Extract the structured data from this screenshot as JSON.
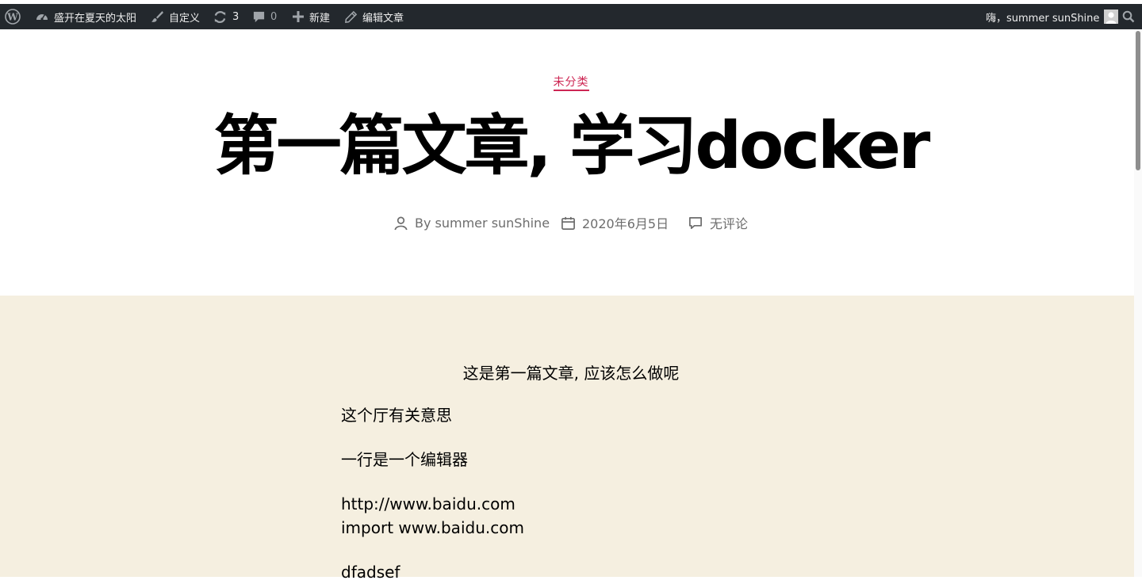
{
  "admin_bar": {
    "site_name": "盛开在夏天的太阳",
    "customize": "自定义",
    "updates_count": "3",
    "comments_count": "0",
    "new_label": "新建",
    "edit_post": "编辑文章",
    "greeting": "嗨，summer sunShine"
  },
  "post": {
    "category": "未分类",
    "title": "第一篇文章, 学习docker",
    "author": "By summer sunShine",
    "date": "2020年6月5日",
    "comments": "无评论"
  },
  "content": {
    "center_paragraph": "这是第一篇文章, 应该怎么做呢",
    "paragraph_1": "这个厅有关意思",
    "paragraph_2": "一行是一个编辑器",
    "paragraph_3_line_1": "http://www.baidu.com",
    "paragraph_3_line_2": "import www.baidu.com",
    "paragraph_4": "dfadsef"
  },
  "colors": {
    "admin_bar_bg": "#23282d",
    "accent": "#cd2653",
    "content_bg": "#f5efe0"
  },
  "icons": [
    "wordpress-icon",
    "dashboard-icon",
    "brush-icon",
    "updates-icon",
    "comment-icon",
    "plus-icon",
    "pencil-icon",
    "avatar",
    "search-icon",
    "person-icon",
    "calendar-icon",
    "comment-outline-icon"
  ]
}
